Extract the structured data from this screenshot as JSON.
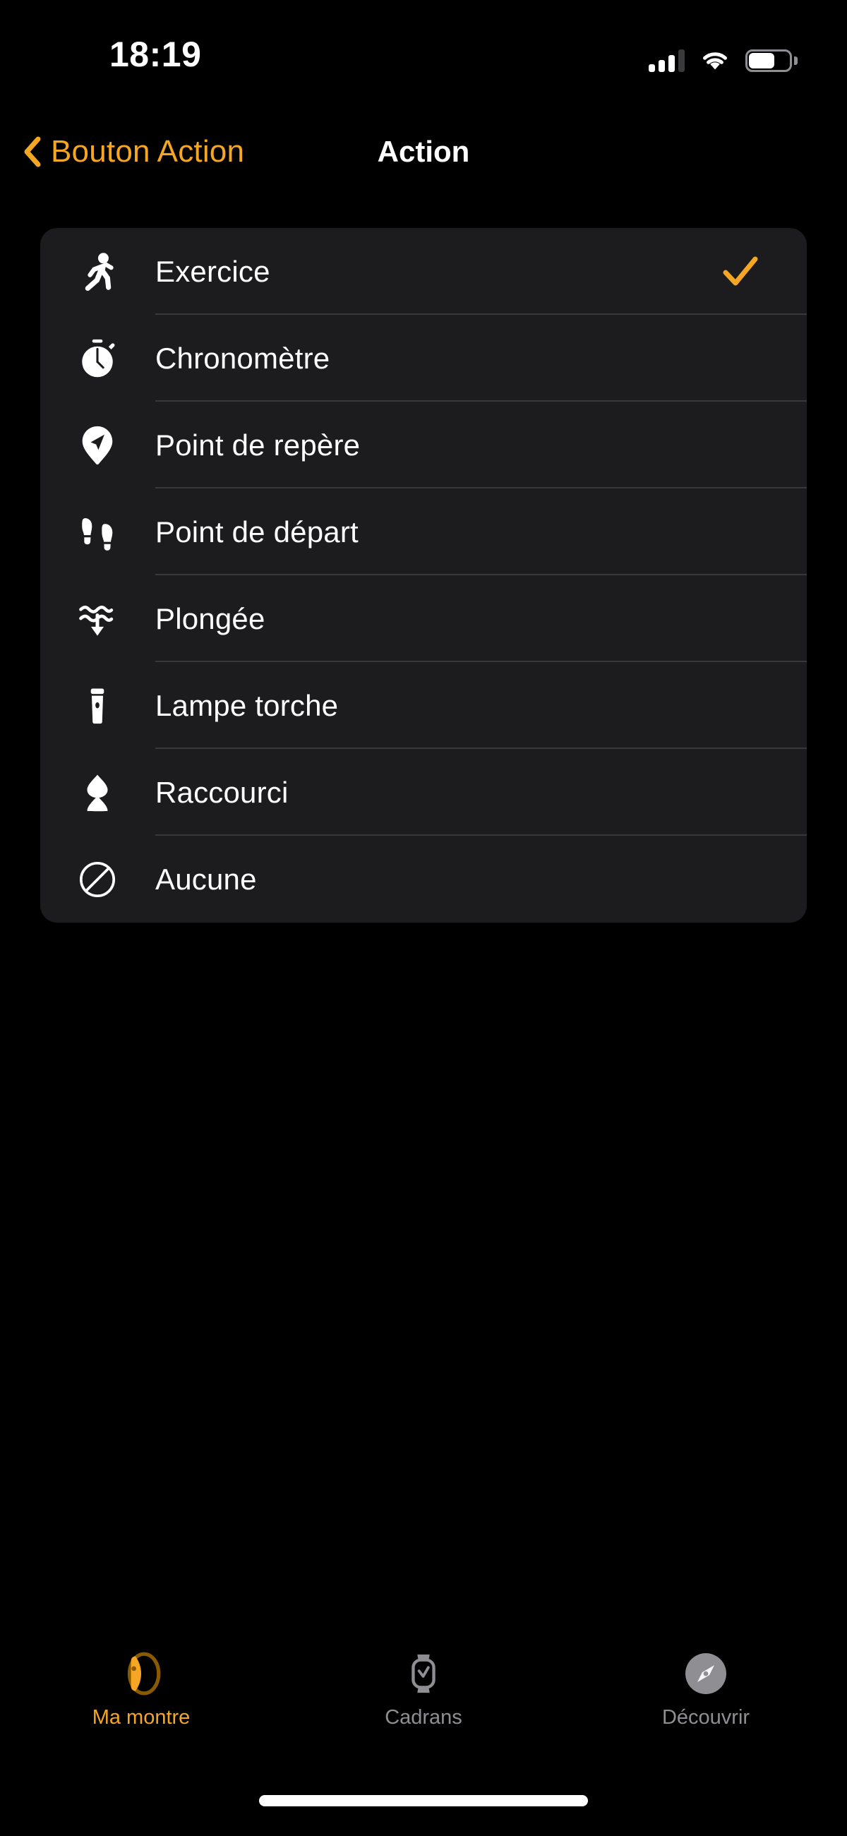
{
  "status_bar": {
    "time": "18:19",
    "cellular_icon": "cellular-signal-icon",
    "cellular_bars_filled": 3,
    "cellular_bars_total": 4,
    "wifi_icon": "wifi-icon",
    "battery_icon": "battery-icon",
    "battery_level_percent": 65
  },
  "nav_bar": {
    "back_icon": "chevron-left-icon",
    "back_label": "Bouton Action",
    "title": "Action"
  },
  "colors": {
    "accent": "#f5a623",
    "background": "#000000",
    "card_background": "#1c1c1e",
    "separator": "#38383a",
    "primary_text": "#ffffff",
    "secondary_text": "#8e8e93"
  },
  "list": {
    "selected_index": 0,
    "check_icon": "checkmark-icon",
    "items": [
      {
        "label": "Exercice",
        "icon": "running-person-icon",
        "selected": true
      },
      {
        "label": "Chronomètre",
        "icon": "stopwatch-icon",
        "selected": false
      },
      {
        "label": "Point de repère",
        "icon": "waypoint-pin-icon",
        "selected": false
      },
      {
        "label": "Point de départ",
        "icon": "footprints-icon",
        "selected": false
      },
      {
        "label": "Plongée",
        "icon": "dive-waves-icon",
        "selected": false
      },
      {
        "label": "Lampe torche",
        "icon": "flashlight-icon",
        "selected": false
      },
      {
        "label": "Raccourci",
        "icon": "shortcuts-layers-icon",
        "selected": false
      },
      {
        "label": "Aucune",
        "icon": "no-entry-slash-icon",
        "selected": false
      }
    ]
  },
  "tab_bar": {
    "active_index": 0,
    "tabs": [
      {
        "label": "Ma montre",
        "icon": "watch-side-icon",
        "active": true
      },
      {
        "label": "Cadrans",
        "icon": "watch-face-icon",
        "active": false
      },
      {
        "label": "Découvrir",
        "icon": "compass-icon",
        "active": false
      }
    ]
  },
  "home_indicator": "home-indicator"
}
